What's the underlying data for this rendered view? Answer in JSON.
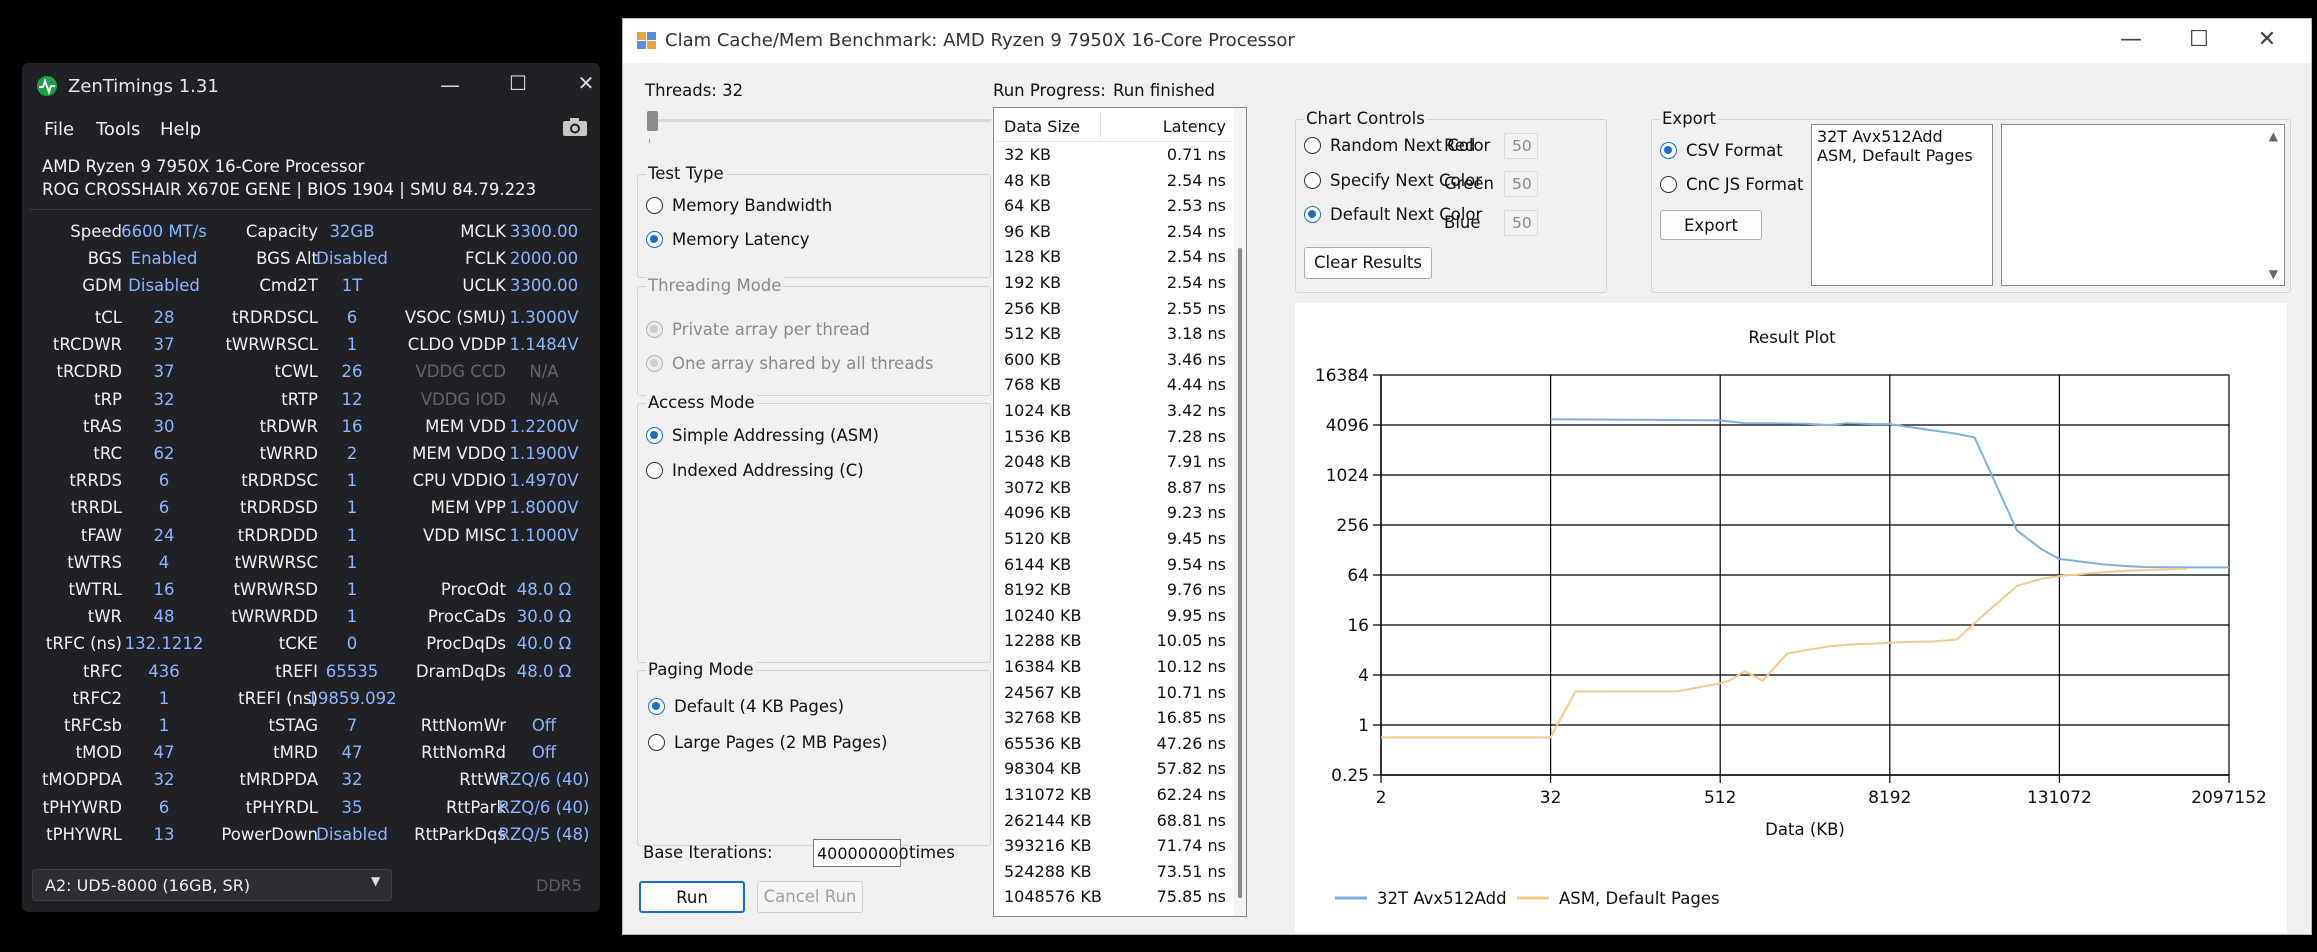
{
  "zentimings": {
    "title": "ZenTimings 1.31",
    "menu": [
      "File",
      "Tools",
      "Help"
    ],
    "cpu": "AMD Ryzen 9 7950X 16-Core Processor",
    "board": "ROG CROSSHAIR X670E GENE | BIOS 1904 | SMU 84.79.223",
    "top_rows": [
      [
        "Speed",
        "6600 MT/s",
        "Capacity",
        "32GB",
        "MCLK",
        "3300.00"
      ],
      [
        "BGS",
        "Enabled",
        "BGS Alt",
        "Disabled",
        "FCLK",
        "2000.00"
      ],
      [
        "GDM",
        "Disabled",
        "Cmd2T",
        "1T",
        "UCLK",
        "3300.00"
      ]
    ],
    "rows": [
      [
        "tCL",
        "28",
        "tRDRDSCL",
        "6",
        "VSOC (SMU)",
        "1.3000V"
      ],
      [
        "tRCDWR",
        "37",
        "tWRWRSCL",
        "1",
        "CLDO VDDP",
        "1.1484V"
      ],
      [
        "tRCDRD",
        "37",
        "tCWL",
        "26",
        "VDDG CCD",
        "N/A"
      ],
      [
        "tRP",
        "32",
        "tRTP",
        "12",
        "VDDG IOD",
        "N/A"
      ],
      [
        "tRAS",
        "30",
        "tRDWR",
        "16",
        "MEM VDD",
        "1.2200V"
      ],
      [
        "tRC",
        "62",
        "tWRRD",
        "2",
        "MEM VDDQ",
        "1.1900V"
      ],
      [
        "tRRDS",
        "6",
        "tRDRDSC",
        "1",
        "CPU VDDIO",
        "1.4970V"
      ],
      [
        "tRRDL",
        "6",
        "tRDRDSD",
        "1",
        "MEM VPP",
        "1.8000V"
      ],
      [
        "tFAW",
        "24",
        "tRDRDDD",
        "1",
        "VDD MISC",
        "1.1000V"
      ],
      [
        "tWTRS",
        "4",
        "tWRWRSC",
        "1",
        "",
        ""
      ],
      [
        "tWTRL",
        "16",
        "tWRWRSD",
        "1",
        "ProcOdt",
        "48.0 Ω"
      ],
      [
        "tWR",
        "48",
        "tWRWRDD",
        "1",
        "ProcCaDs",
        "30.0 Ω"
      ],
      [
        "tRFC (ns)",
        "132.1212",
        "tCKE",
        "0",
        "ProcDqDs",
        "40.0 Ω"
      ],
      [
        "tRFC",
        "436",
        "tREFI",
        "65535",
        "DramDqDs",
        "48.0 Ω"
      ],
      [
        "tRFC2",
        "1",
        "tREFI (ns)",
        "19859.092",
        "",
        ""
      ],
      [
        "tRFCsb",
        "1",
        "tSTAG",
        "7",
        "RttNomWr",
        "Off"
      ],
      [
        "tMOD",
        "47",
        "tMRD",
        "47",
        "RttNomRd",
        "Off"
      ],
      [
        "tMODPDA",
        "32",
        "tMRDPDA",
        "32",
        "RttWr",
        "RZQ/6 (40)"
      ],
      [
        "tPHYWRD",
        "6",
        "tPHYRDL",
        "35",
        "RttPark",
        "RZQ/6 (40)"
      ],
      [
        "tPHYWRL",
        "13",
        "PowerDown",
        "Disabled",
        "RttParkDqs",
        "RZQ/5 (48)"
      ]
    ],
    "dim_labels": [
      "VDDG CCD",
      "VDDG IOD"
    ],
    "dimm_select": "A2: UD5-8000 (16GB, SR)",
    "ddr": "DDR5"
  },
  "clam": {
    "title": "Clam Cache/Mem Benchmark: AMD Ryzen 9 7950X 16-Core Processor",
    "threads_label": "Threads: 32",
    "test_type": {
      "legend": "Test Type",
      "options": [
        "Memory Bandwidth",
        "Memory Latency"
      ],
      "selected": 1
    },
    "threading_mode": {
      "legend": "Threading Mode",
      "options": [
        "Private array per thread",
        "One array shared by all threads"
      ]
    },
    "access_mode": {
      "legend": "Access Mode",
      "options": [
        "Simple Addressing (ASM)",
        "Indexed Addressing (C)"
      ],
      "selected": 0
    },
    "paging_mode": {
      "legend": "Paging Mode",
      "options": [
        "Default (4 KB Pages)",
        "Large Pages (2 MB Pages)"
      ],
      "selected": 0
    },
    "base_iterations_label": "Base Iterations:",
    "base_iterations": "400000000",
    "times_label": "times",
    "run_button": "Run",
    "cancel_button": "Cancel Run",
    "run_progress_label": "Run Progress:",
    "run_progress_value": "Run finished",
    "table": {
      "headers": [
        "Data Size",
        "Latency"
      ],
      "rows": [
        [
          "32 KB",
          "0.71 ns"
        ],
        [
          "48 KB",
          "2.54 ns"
        ],
        [
          "64 KB",
          "2.53 ns"
        ],
        [
          "96 KB",
          "2.54 ns"
        ],
        [
          "128 KB",
          "2.54 ns"
        ],
        [
          "192 KB",
          "2.54 ns"
        ],
        [
          "256 KB",
          "2.55 ns"
        ],
        [
          "512 KB",
          "3.18 ns"
        ],
        [
          "600 KB",
          "3.46 ns"
        ],
        [
          "768 KB",
          "4.44 ns"
        ],
        [
          "1024 KB",
          "3.42 ns"
        ],
        [
          "1536 KB",
          "7.28 ns"
        ],
        [
          "2048 KB",
          "7.91 ns"
        ],
        [
          "3072 KB",
          "8.87 ns"
        ],
        [
          "4096 KB",
          "9.23 ns"
        ],
        [
          "5120 KB",
          "9.45 ns"
        ],
        [
          "6144 KB",
          "9.54 ns"
        ],
        [
          "8192 KB",
          "9.76 ns"
        ],
        [
          "10240 KB",
          "9.95 ns"
        ],
        [
          "12288 KB",
          "10.05 ns"
        ],
        [
          "16384 KB",
          "10.12 ns"
        ],
        [
          "24567 KB",
          "10.71 ns"
        ],
        [
          "32768 KB",
          "16.85 ns"
        ],
        [
          "65536 KB",
          "47.26 ns"
        ],
        [
          "98304 KB",
          "57.82 ns"
        ],
        [
          "131072 KB",
          "62.24 ns"
        ],
        [
          "262144 KB",
          "68.81 ns"
        ],
        [
          "393216 KB",
          "71.74 ns"
        ],
        [
          "524288 KB",
          "73.51 ns"
        ],
        [
          "1048576 KB",
          "75.85 ns"
        ]
      ]
    },
    "chart_controls": {
      "legend": "Chart Controls",
      "options": [
        "Random Next Color",
        "Specify Next Color",
        "Default Next Color"
      ],
      "selected": 2,
      "rgb": [
        [
          "Red",
          "50"
        ],
        [
          "Green",
          "50"
        ],
        [
          "Blue",
          "50"
        ]
      ],
      "clear_button": "Clear Results"
    },
    "export": {
      "legend": "Export",
      "options": [
        "CSV Format",
        "CnC JS Format"
      ],
      "selected": 0,
      "button": "Export",
      "list_items": [
        "32T Avx512Add",
        "ASM, Default Pages"
      ]
    }
  },
  "colors": {
    "series1": "#7fb0e0",
    "series2": "#f5c98a",
    "zt_value": "#8cb4ff",
    "accent": "#1a6dc7"
  },
  "chart_data": {
    "type": "line",
    "title": "Result Plot",
    "xlabel": "Data (KB)",
    "ylabel": "",
    "x_scale": "log2",
    "y_scale": "log2",
    "x_ticks": [
      "2",
      "32",
      "512",
      "8192",
      "131072",
      "2097152"
    ],
    "y_ticks": [
      "0.25",
      "1",
      "4",
      "16",
      "64",
      "256",
      "1024",
      "4096",
      "16384"
    ],
    "xlim": [
      2,
      2097152
    ],
    "ylim": [
      0.25,
      16384
    ],
    "grid": true,
    "legend_position": "bottom-left",
    "series": [
      {
        "name": "32T Avx512Add",
        "color": "#7fb0e0",
        "points": [
          [
            32,
            4800
          ],
          [
            128,
            4750
          ],
          [
            512,
            4650
          ],
          [
            768,
            4300
          ],
          [
            1024,
            4300
          ],
          [
            2048,
            4250
          ],
          [
            3072,
            4100
          ],
          [
            4096,
            4300
          ],
          [
            6144,
            4200
          ],
          [
            8192,
            4200
          ],
          [
            12288,
            3800
          ],
          [
            24567,
            3200
          ],
          [
            32768,
            2900
          ],
          [
            65536,
            220
          ],
          [
            98304,
            130
          ],
          [
            131072,
            100
          ],
          [
            262144,
            86
          ],
          [
            393216,
            82
          ],
          [
            524288,
            80
          ],
          [
            1048576,
            79
          ],
          [
            2097152,
            79
          ]
        ]
      },
      {
        "name": "ASM, Default Pages",
        "color": "#f5c98a",
        "points": [
          [
            2,
            0.71
          ],
          [
            32,
            0.71
          ],
          [
            48,
            2.54
          ],
          [
            64,
            2.53
          ],
          [
            96,
            2.54
          ],
          [
            128,
            2.54
          ],
          [
            192,
            2.54
          ],
          [
            256,
            2.55
          ],
          [
            512,
            3.18
          ],
          [
            600,
            3.46
          ],
          [
            768,
            4.44
          ],
          [
            1024,
            3.42
          ],
          [
            1536,
            7.28
          ],
          [
            2048,
            7.91
          ],
          [
            3072,
            8.87
          ],
          [
            4096,
            9.23
          ],
          [
            5120,
            9.45
          ],
          [
            6144,
            9.54
          ],
          [
            8192,
            9.76
          ],
          [
            10240,
            9.95
          ],
          [
            12288,
            10.05
          ],
          [
            16384,
            10.12
          ],
          [
            24567,
            10.71
          ],
          [
            32768,
            16.85
          ],
          [
            65536,
            47.26
          ],
          [
            98304,
            57.82
          ],
          [
            131072,
            62.24
          ],
          [
            262144,
            68.81
          ],
          [
            393216,
            71.74
          ],
          [
            524288,
            73.51
          ],
          [
            1048576,
            75.85
          ]
        ]
      }
    ]
  }
}
